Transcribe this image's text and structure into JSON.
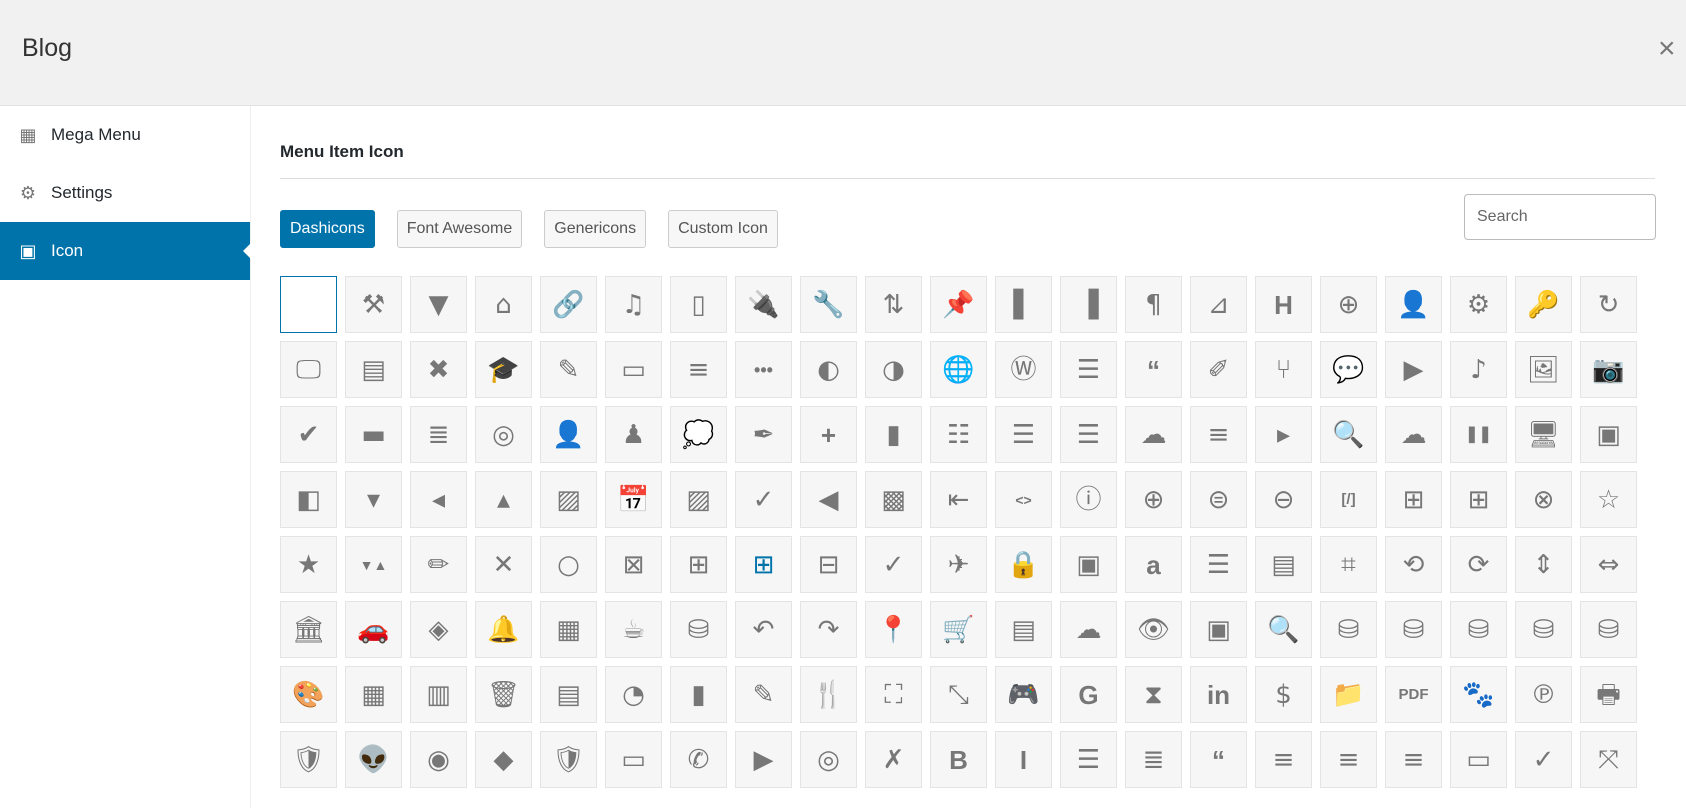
{
  "header": {
    "title": "Blog",
    "close_label": "×"
  },
  "sidebar": {
    "items": [
      {
        "label": "Mega Menu",
        "icon": "mega-menu-grid-icon",
        "glyph": "▦",
        "active": false
      },
      {
        "label": "Settings",
        "icon": "gear-icon",
        "glyph": "⚙",
        "active": false
      },
      {
        "label": "Icon",
        "icon": "image-icon",
        "glyph": "▣",
        "active": true
      }
    ]
  },
  "main": {
    "title": "Menu Item Icon",
    "tabs": [
      {
        "label": "Dashicons",
        "active": true
      },
      {
        "label": "Font Awesome",
        "active": false
      },
      {
        "label": "Genericons",
        "active": false
      },
      {
        "label": "Custom Icon",
        "active": false
      }
    ],
    "search": {
      "placeholder": "Search",
      "value": ""
    }
  },
  "icons": [
    [
      "blank",
      "",
      ""
    ],
    [
      "hammer",
      "⚒",
      ""
    ],
    [
      "comment",
      "▼",
      ""
    ],
    [
      "home",
      "⌂",
      ""
    ],
    [
      "link",
      "🔗",
      ""
    ],
    [
      "media",
      "♫",
      ""
    ],
    [
      "page",
      "▯",
      ""
    ],
    [
      "plugin",
      "🔌",
      ""
    ],
    [
      "wrench",
      "🔧",
      ""
    ],
    [
      "sort",
      "⇅",
      ""
    ],
    [
      "pin",
      "📌",
      ""
    ],
    [
      "columns-left",
      "▌",
      ""
    ],
    [
      "columns-right",
      "▐",
      ""
    ],
    [
      "paragraph",
      "¶",
      ""
    ],
    [
      "chart",
      "⊿",
      ""
    ],
    [
      "heading",
      "H",
      "txt"
    ],
    [
      "plus-circle",
      "⊕",
      ""
    ],
    [
      "user",
      "👤",
      ""
    ],
    [
      "gear",
      "⚙",
      ""
    ],
    [
      "key",
      "🔑",
      ""
    ],
    [
      "refresh",
      "↻",
      ""
    ],
    [
      "screen",
      "🖵",
      ""
    ],
    [
      "table",
      "▤",
      ""
    ],
    [
      "comment-x",
      "✖",
      ""
    ],
    [
      "graduation",
      "🎓",
      ""
    ],
    [
      "edit",
      "✎",
      ""
    ],
    [
      "button",
      "▭",
      ""
    ],
    [
      "align-center",
      "≡",
      ""
    ],
    [
      "ellipsis",
      "•••",
      "txt"
    ],
    [
      "globe-dark",
      "◐",
      ""
    ],
    [
      "earth",
      "◑",
      ""
    ],
    [
      "globe",
      "🌐",
      ""
    ],
    [
      "wordpress",
      "Ⓦ",
      ""
    ],
    [
      "document",
      "☰",
      ""
    ],
    [
      "quote",
      "“",
      "txt"
    ],
    [
      "note",
      "✐",
      ""
    ],
    [
      "fork",
      "⑂",
      ""
    ],
    [
      "chat",
      "💬",
      ""
    ],
    [
      "video",
      "▶",
      ""
    ],
    [
      "music",
      "♪",
      ""
    ],
    [
      "picture",
      "🖼",
      ""
    ],
    [
      "camera",
      "📷",
      ""
    ],
    [
      "check-circle",
      "✔",
      ""
    ],
    [
      "battery",
      "▬",
      ""
    ],
    [
      "ordered-list",
      "≣",
      ""
    ],
    [
      "instagram",
      "◎",
      ""
    ],
    [
      "person",
      "👤",
      ""
    ],
    [
      "person-tie",
      "♟",
      ""
    ],
    [
      "chat-dots",
      "💭",
      ""
    ],
    [
      "dropper",
      "✒",
      ""
    ],
    [
      "plus",
      "+",
      "txt"
    ],
    [
      "page-add",
      "▮",
      ""
    ],
    [
      "align-stack",
      "☷",
      ""
    ],
    [
      "text-wrap",
      "☰",
      ""
    ],
    [
      "list",
      "☰",
      ""
    ],
    [
      "cloud-check",
      "☁",
      ""
    ],
    [
      "align-left",
      "≡",
      ""
    ],
    [
      "caret-right",
      "▸",
      ""
    ],
    [
      "search-zoom",
      "🔍",
      ""
    ],
    [
      "cloud-upload",
      "☁",
      ""
    ],
    [
      "pause",
      "❚❚",
      "txt"
    ],
    [
      "monitor",
      "🖥",
      ""
    ],
    [
      "video-code",
      "▣",
      ""
    ],
    [
      "code-slider",
      "◧",
      ""
    ],
    [
      "arrow-down",
      "▾",
      ""
    ],
    [
      "arrow-left",
      "◂",
      ""
    ],
    [
      "arrow-up",
      "▴",
      ""
    ],
    [
      "image-code",
      "▨",
      ""
    ],
    [
      "calendar",
      "📅",
      ""
    ],
    [
      "image-pin",
      "▨",
      ""
    ],
    [
      "check",
      "✓",
      ""
    ],
    [
      "play-back",
      "◀",
      ""
    ],
    [
      "video-tag",
      "▩",
      ""
    ],
    [
      "exit",
      "⇤",
      ""
    ],
    [
      "html",
      "<>",
      "txt"
    ],
    [
      "info",
      "ⓘ",
      ""
    ],
    [
      "zoom-in",
      "⊕",
      ""
    ],
    [
      "upload-circle",
      "⊜",
      ""
    ],
    [
      "minus-circle",
      "⊖",
      ""
    ],
    [
      "shortcode",
      "[/]",
      "txt"
    ],
    [
      "table-row-after",
      "⊞",
      ""
    ],
    [
      "table-col-after",
      "⊞",
      ""
    ],
    [
      "x-circle",
      "⊗",
      ""
    ],
    [
      "star-empty",
      "☆",
      ""
    ],
    [
      "star-filled",
      "★",
      ""
    ],
    [
      "sort-triangles",
      "▼▲",
      "txt"
    ],
    [
      "page-edit",
      "✏",
      ""
    ],
    [
      "times",
      "✕",
      ""
    ],
    [
      "ring",
      "○",
      ""
    ],
    [
      "table-delete",
      "⊠",
      ""
    ],
    [
      "table-add",
      "⊞",
      ""
    ],
    [
      "table-active",
      "⊞",
      "bluetxt"
    ],
    [
      "table-remove",
      "⊟",
      ""
    ],
    [
      "check-thin",
      "✓",
      ""
    ],
    [
      "airplane",
      "✈",
      ""
    ],
    [
      "lock",
      "🔒",
      ""
    ],
    [
      "image-stack",
      "▣",
      ""
    ],
    [
      "amazon",
      "a",
      "txt"
    ],
    [
      "list-view",
      "☰",
      ""
    ],
    [
      "layout",
      "▤",
      ""
    ],
    [
      "crop",
      "⌗",
      ""
    ],
    [
      "rotate-left",
      "⟲",
      ""
    ],
    [
      "rotate-right",
      "⟳",
      ""
    ],
    [
      "flip-vertical",
      "⇕",
      ""
    ],
    [
      "flip-horizontal",
      "⇔",
      ""
    ],
    [
      "bank",
      "🏛",
      ""
    ],
    [
      "car",
      "🚗",
      ""
    ],
    [
      "tag-diagonal",
      "◈",
      ""
    ],
    [
      "bell",
      "🔔",
      ""
    ],
    [
      "calculator",
      "▦",
      ""
    ],
    [
      "coffee",
      "☕",
      ""
    ],
    [
      "database-add",
      "⛁",
      ""
    ],
    [
      "undo",
      "↶",
      ""
    ],
    [
      "redo",
      "↷",
      ""
    ],
    [
      "location-pin",
      "📍",
      ""
    ],
    [
      "cart",
      "🛒",
      ""
    ],
    [
      "id-card",
      "▤",
      ""
    ],
    [
      "cloud",
      "☁",
      ""
    ],
    [
      "eye",
      "👁",
      ""
    ],
    [
      "vault",
      "▣",
      ""
    ],
    [
      "magnifier",
      "🔍",
      ""
    ],
    [
      "database-upload",
      "⛁",
      ""
    ],
    [
      "database-download",
      "⛁",
      ""
    ],
    [
      "database-remove",
      "⛁",
      ""
    ],
    [
      "database-check",
      "⛁",
      ""
    ],
    [
      "database",
      "⛁",
      ""
    ],
    [
      "palette",
      "🎨",
      ""
    ],
    [
      "grid",
      "▦",
      ""
    ],
    [
      "tickets",
      "▥",
      ""
    ],
    [
      "trash",
      "🗑",
      ""
    ],
    [
      "form",
      "▤",
      ""
    ],
    [
      "pie-chart",
      "◔",
      ""
    ],
    [
      "bar-chart",
      "▮",
      ""
    ],
    [
      "edit-page",
      "✎",
      ""
    ],
    [
      "restaurant",
      "🍴",
      ""
    ],
    [
      "fullscreen",
      "⛶",
      ""
    ],
    [
      "exit-fullscreen",
      "⤡",
      ""
    ],
    [
      "games",
      "🎮",
      ""
    ],
    [
      "google",
      "G",
      "txt"
    ],
    [
      "hourglass",
      "⧗",
      ""
    ],
    [
      "linkedin",
      "in",
      "txt"
    ],
    [
      "dollar",
      "$",
      ""
    ],
    [
      "folder",
      "📁",
      ""
    ],
    [
      "pdf",
      "PDF",
      "txt"
    ],
    [
      "paw",
      "🐾",
      ""
    ],
    [
      "pinterest",
      "℗",
      ""
    ],
    [
      "printer",
      "🖶",
      ""
    ],
    [
      "shield-lock",
      "🛡",
      ""
    ],
    [
      "reddit",
      "👽",
      ""
    ],
    [
      "spotify",
      "◉",
      ""
    ],
    [
      "diamond",
      "◆",
      ""
    ],
    [
      "shield-slash",
      "🛡",
      ""
    ],
    [
      "twitch",
      "▭",
      ""
    ],
    [
      "whatsapp",
      "✆",
      ""
    ],
    [
      "youtube",
      "▶",
      ""
    ],
    [
      "podcast",
      "◎",
      ""
    ],
    [
      "xing",
      "✗",
      ""
    ],
    [
      "bold",
      "B",
      "txt"
    ],
    [
      "italic",
      "I",
      "txt"
    ],
    [
      "bullet-list",
      "☰",
      ""
    ],
    [
      "numbered-list",
      "≣",
      ""
    ],
    [
      "blockquote",
      "“",
      "txt"
    ],
    [
      "text-left",
      "≡",
      ""
    ],
    [
      "text-center",
      "≡",
      ""
    ],
    [
      "text-right",
      "≡",
      ""
    ],
    [
      "read-more",
      "▭",
      ""
    ],
    [
      "spellcheck",
      "✓",
      ""
    ],
    [
      "expand",
      "⤧",
      ""
    ]
  ]
}
